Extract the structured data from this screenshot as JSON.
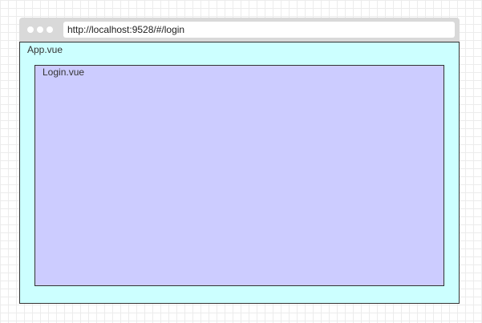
{
  "browser": {
    "url": "http://localhost:9528/#/login"
  },
  "app": {
    "label": "App.vue",
    "color": "#ccffff"
  },
  "login": {
    "label": "Login.vue",
    "color": "#ccccff"
  }
}
